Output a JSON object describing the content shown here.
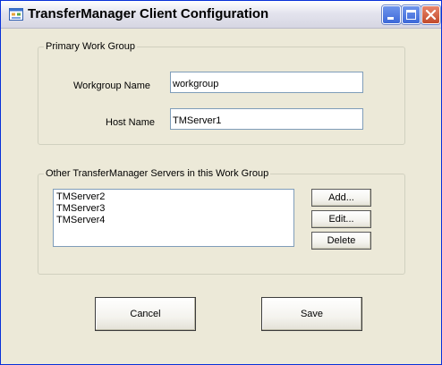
{
  "window": {
    "title": "TransferManager Client Configuration"
  },
  "primary_group": {
    "legend": "Primary Work Group",
    "workgroup_label": "Workgroup Name",
    "workgroup_value": "workgroup",
    "host_label": "Host Name",
    "host_value": "TMServer1"
  },
  "servers_group": {
    "legend": "Other TransferManager Servers in this Work Group",
    "servers": [
      "TMServer2",
      "TMServer3",
      "TMServer4"
    ],
    "add_label": "Add...",
    "edit_label": "Edit...",
    "delete_label": "Delete"
  },
  "footer": {
    "cancel_label": "Cancel",
    "save_label": "Save"
  },
  "colors": {
    "face": "#ece9d8",
    "border": "#7f9db9",
    "close": "#c24a2a",
    "accent": "#3c68d8"
  },
  "icons": {
    "app": "app-window-icon",
    "minimize": "minimize-icon",
    "maximize": "maximize-icon",
    "close": "close-icon"
  }
}
